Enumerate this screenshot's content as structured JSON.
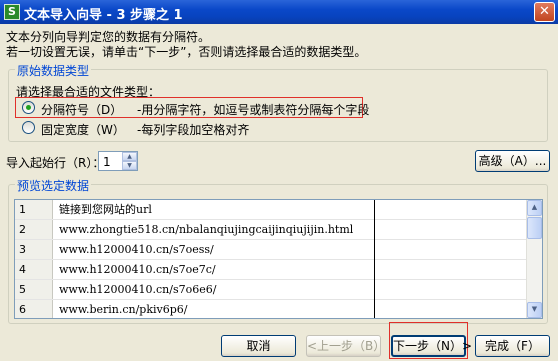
{
  "window": {
    "title": "文本导入向导 - 3 步骤之 1",
    "app_icon_glyph": "S",
    "close_glyph": "✕"
  },
  "intro": {
    "line1": "文本分列向导判定您的数据有分隔符。",
    "line2": "若一切设置无误，请单击“下一步”，否则请选择最合适的数据类型。"
  },
  "original_type": {
    "group_label": "原始数据类型",
    "prompt": "请选择最合适的文件类型：",
    "options": [
      {
        "label": "分隔符号（D）",
        "desc": "-用分隔字符，如逗号或制表符分隔每个字段",
        "selected": true
      },
      {
        "label": "固定宽度（W）",
        "desc": "-每列字段加空格对齐",
        "selected": false
      }
    ]
  },
  "start_row": {
    "label": "导入起始行（R）：",
    "value": "1"
  },
  "advanced_button": "高级（A）...",
  "preview": {
    "group_label": "预览选定数据",
    "rows": [
      {
        "n": "1",
        "v": "链接到您网站的url"
      },
      {
        "n": "2",
        "v": "www.zhongtie518.cn/nbalanqiujingcaijinqiujijin.html"
      },
      {
        "n": "3",
        "v": "www.h12000410.cn/s7oess/"
      },
      {
        "n": "4",
        "v": "www.h12000410.cn/s7oe7c/"
      },
      {
        "n": "5",
        "v": "www.h12000410.cn/s7o6e6/"
      },
      {
        "n": "6",
        "v": "www.berin.cn/pkiv6p6/"
      }
    ]
  },
  "buttons": {
    "cancel": "取消",
    "back": "<上一步（B）",
    "next": "下一步（N）>",
    "finish": "完成（F）"
  },
  "colors": {
    "accent_title": "#0a48c8",
    "group_label": "#0046d5",
    "highlight_box": "#e0302a"
  }
}
